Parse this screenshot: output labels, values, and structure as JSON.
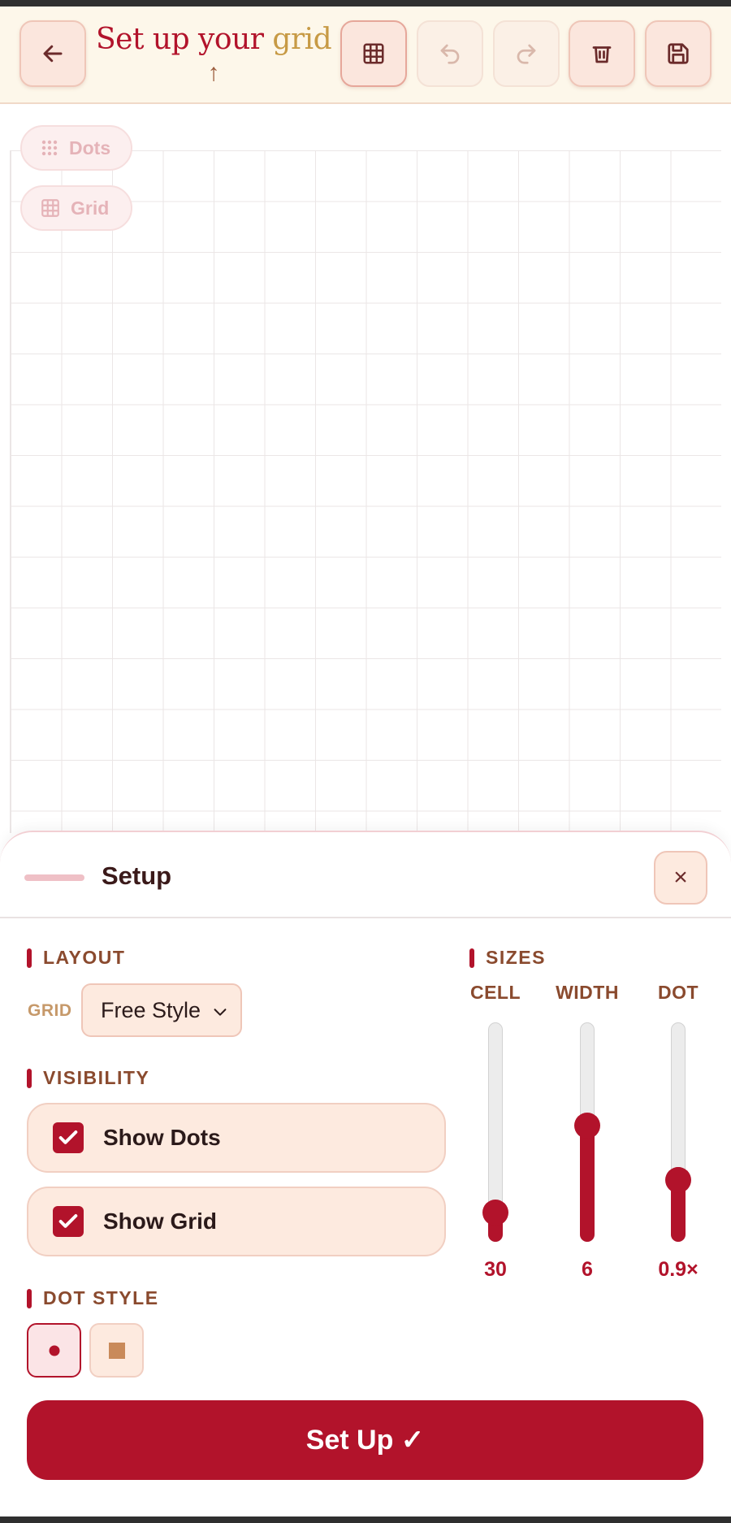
{
  "header": {
    "title_main": "Set up your ",
    "title_accent": "grid",
    "title_arrow": "↑",
    "buttons": [
      {
        "icon": "arrow-left-icon",
        "state": "enabled"
      },
      {
        "icon": "grid-icon",
        "state": "active"
      },
      {
        "icon": "undo-icon",
        "state": "disabled"
      },
      {
        "icon": "redo-icon",
        "state": "disabled"
      },
      {
        "icon": "trash-icon",
        "state": "enabled"
      },
      {
        "icon": "save-icon",
        "state": "enabled"
      }
    ]
  },
  "canvas": {
    "toggles": [
      {
        "icon": "dots-icon",
        "label": "Dots"
      },
      {
        "icon": "grid-icon",
        "label": "Grid"
      }
    ]
  },
  "sheet": {
    "title": "Setup",
    "close_label": "×",
    "layout": {
      "heading": "LAYOUT",
      "grid_label": "GRID",
      "grid_value": "Free Style"
    },
    "visibility": {
      "heading": "VISIBILITY",
      "options": [
        {
          "label": "Show Dots",
          "checked": true
        },
        {
          "label": "Show Grid",
          "checked": true
        }
      ]
    },
    "dot_style": {
      "heading": "DOT STYLE",
      "options": [
        {
          "icon": "round-dot-icon",
          "selected": true
        },
        {
          "icon": "square-dot-icon",
          "selected": false
        }
      ]
    },
    "sizes": {
      "heading": "SIZES",
      "sliders": [
        {
          "label": "CELL",
          "value": "30",
          "level": 0.08
        },
        {
          "label": "WIDTH",
          "value": "6",
          "level": 0.53
        },
        {
          "label": "DOT",
          "value": "0.9×",
          "level": 0.25
        }
      ]
    },
    "primary_label": "Set Up ✓"
  },
  "colors": {
    "accent": "#b2132b",
    "header_bg": "#fdf7ea",
    "button_bg": "#fbe6dd",
    "label_brown": "#8a4a2e",
    "gold": "#c79a45"
  }
}
